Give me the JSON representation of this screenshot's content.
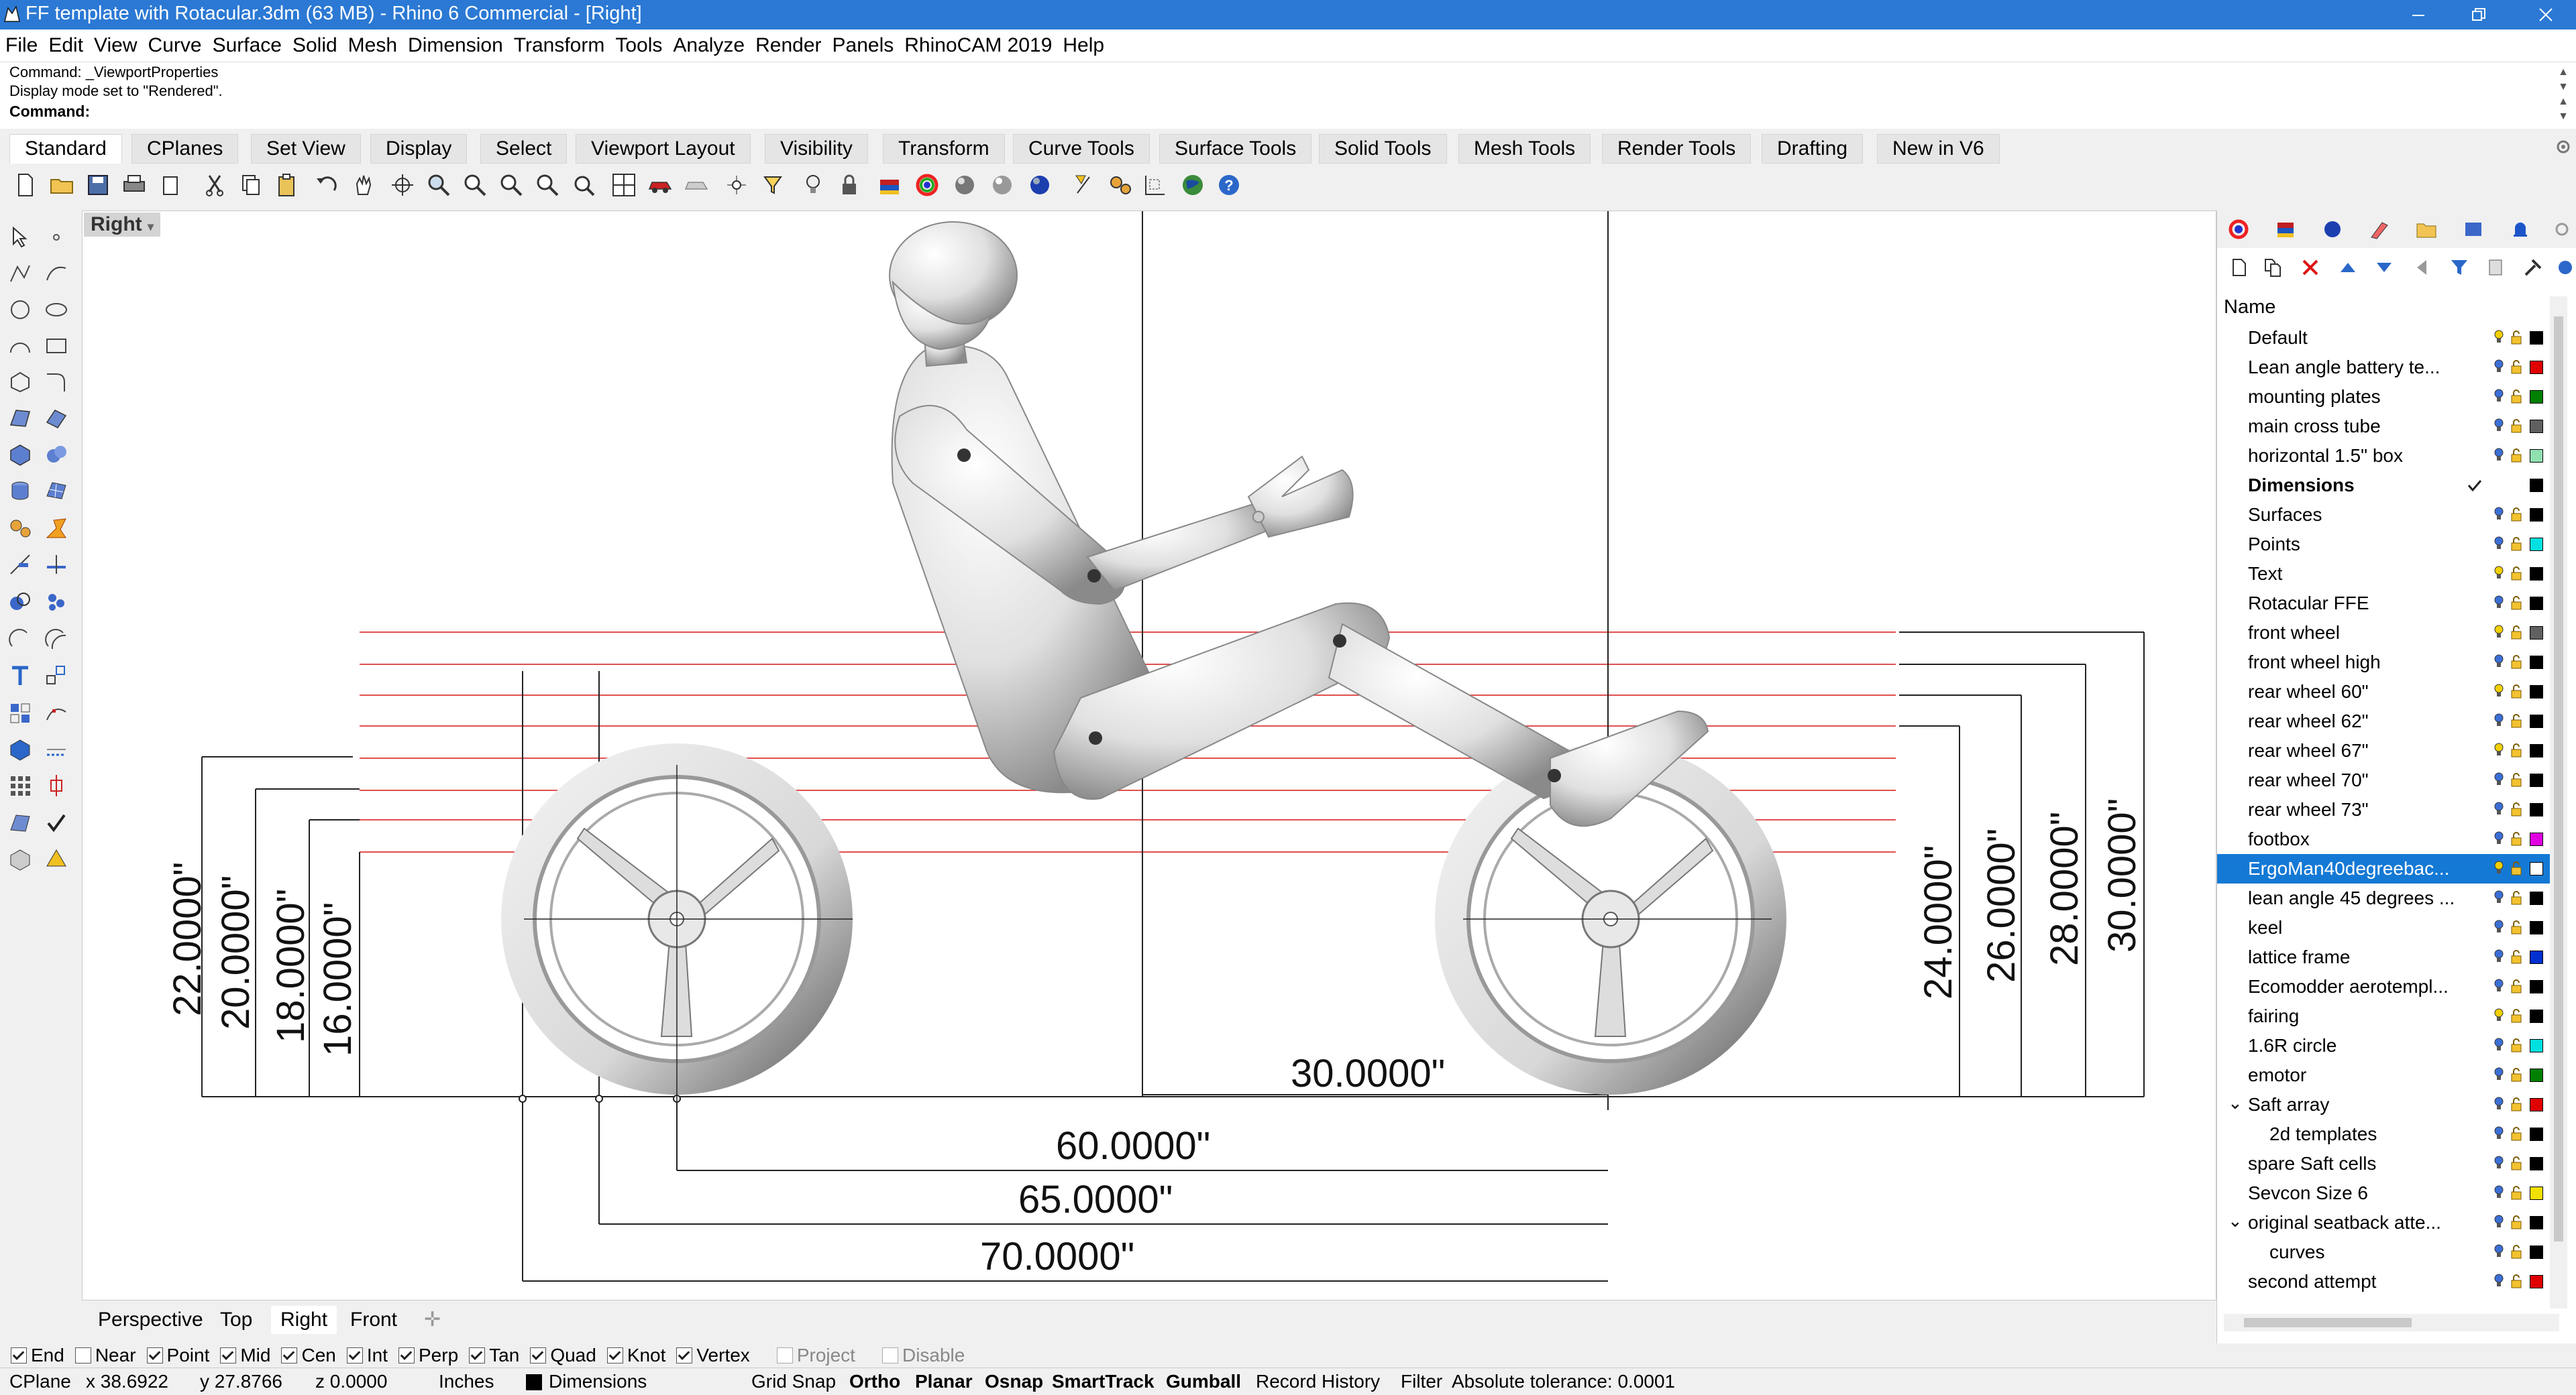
{
  "window": {
    "title": "FF template with Rotacular.3dm (63 MB) - Rhino 6 Commercial - [Right]",
    "minimize_icon": "minimize-icon",
    "restore_icon": "restore-icon",
    "close_icon": "close-icon"
  },
  "menu": [
    "File",
    "Edit",
    "View",
    "Curve",
    "Surface",
    "Solid",
    "Mesh",
    "Dimension",
    "Transform",
    "Tools",
    "Analyze",
    "Render",
    "Panels",
    "RhinoCAM 2019",
    "Help"
  ],
  "command": {
    "history": [
      "Command: _ViewportProperties",
      "Display mode set to \"Rendered\"."
    ],
    "prompt": "Command:"
  },
  "toolbar_tabs": [
    "Standard",
    "CPlanes",
    "Set View",
    "Display",
    "Select",
    "Viewport Layout",
    "Visibility",
    "Transform",
    "Curve Tools",
    "Surface Tools",
    "Solid Tools",
    "Mesh Tools",
    "Render Tools",
    "Drafting",
    "New in V6"
  ],
  "active_tab": "Standard",
  "viewport": {
    "label": "Right",
    "tabs": [
      "Perspective",
      "Top",
      "Right",
      "Front"
    ],
    "selected_tab": "Right",
    "dimensions": {
      "d22": "22.0000\"",
      "d20": "20.0000\"",
      "d18": "18.0000\"",
      "d16": "16.0000\"",
      "d24": "24.0000\"",
      "d26": "26.0000\"",
      "d28": "28.0000\"",
      "d30v": "30.0000\"",
      "d30h": "30.0000\"",
      "d60": "60.0000\"",
      "d65": "65.0000\"",
      "d70": "70.0000\""
    }
  },
  "layers": {
    "header": "Name",
    "rows": [
      {
        "name": "Default",
        "color": "#000000",
        "bulb": "#f2d000"
      },
      {
        "name": "Lean angle battery te...",
        "color": "#e00000",
        "bulb": "#3b6fd6"
      },
      {
        "name": "mounting plates",
        "color": "#008000",
        "bulb": "#3b6fd6"
      },
      {
        "name": "main cross tube",
        "color": "#606060",
        "bulb": "#3b6fd6"
      },
      {
        "name": "horizontal 1.5\" box",
        "color": "#90e0b0",
        "bulb": "#3b6fd6"
      },
      {
        "name": "Dimensions",
        "color": "#000000",
        "bulb": "",
        "current": true
      },
      {
        "name": "Surfaces",
        "color": "#000000",
        "bulb": "#3b6fd6"
      },
      {
        "name": "Points",
        "color": "#00e0e0",
        "bulb": "#3b6fd6"
      },
      {
        "name": "Text",
        "color": "#000000",
        "bulb": "#f2d000"
      },
      {
        "name": "Rotacular FFE",
        "color": "#000000",
        "bulb": "#3b6fd6"
      },
      {
        "name": "front wheel",
        "color": "#606060",
        "bulb": "#f2d000"
      },
      {
        "name": "front wheel high",
        "color": "#000000",
        "bulb": "#3b6fd6"
      },
      {
        "name": "rear wheel 60\"",
        "color": "#000000",
        "bulb": "#f2d000"
      },
      {
        "name": "rear wheel 62\"",
        "color": "#000000",
        "bulb": "#3b6fd6"
      },
      {
        "name": "rear wheel 67\"",
        "color": "#000000",
        "bulb": "#f2d000"
      },
      {
        "name": "rear wheel 70\"",
        "color": "#000000",
        "bulb": "#3b6fd6"
      },
      {
        "name": "rear wheel 73\"",
        "color": "#000000",
        "bulb": "#3b6fd6"
      },
      {
        "name": "footbox",
        "color": "#e000e0",
        "bulb": "#3b6fd6"
      },
      {
        "name": "ErgoMan40degreebac...",
        "color": "#ffffff",
        "bulb": "#f2d000",
        "selected": true
      },
      {
        "name": "lean angle 45 degrees ...",
        "color": "#000000",
        "bulb": "#3b6fd6"
      },
      {
        "name": "keel",
        "color": "#000000",
        "bulb": "#3b6fd6"
      },
      {
        "name": "lattice frame",
        "color": "#0030d0",
        "bulb": "#3b6fd6"
      },
      {
        "name": "Ecomodder aerotempl...",
        "color": "#000000",
        "bulb": "#3b6fd6"
      },
      {
        "name": "fairing",
        "color": "#000000",
        "bulb": "#f2d000"
      },
      {
        "name": "1.6R circle",
        "color": "#00e0e0",
        "bulb": "#3b6fd6"
      },
      {
        "name": "emotor",
        "color": "#008000",
        "bulb": "#3b6fd6"
      },
      {
        "name": "Saft array",
        "color": "#e00000",
        "bulb": "#3b6fd6",
        "expand": "⌄"
      },
      {
        "name": "2d templates",
        "color": "#000000",
        "bulb": "#3b6fd6",
        "indent": true
      },
      {
        "name": "spare Saft cells",
        "color": "#000000",
        "bulb": "#3b6fd6"
      },
      {
        "name": "Sevcon Size 6",
        "color": "#f2e000",
        "bulb": "#3b6fd6"
      },
      {
        "name": "original seatback atte...",
        "color": "#000000",
        "bulb": "#3b6fd6",
        "expand": "⌄"
      },
      {
        "name": "curves",
        "color": "#000000",
        "bulb": "#3b6fd6",
        "indent": true
      },
      {
        "name": "second attempt",
        "color": "#e00000",
        "bulb": "#3b6fd6"
      }
    ]
  },
  "osnaps": [
    {
      "label": "End",
      "on": true
    },
    {
      "label": "Near",
      "on": false
    },
    {
      "label": "Point",
      "on": true
    },
    {
      "label": "Mid",
      "on": true
    },
    {
      "label": "Cen",
      "on": true
    },
    {
      "label": "Int",
      "on": true
    },
    {
      "label": "Perp",
      "on": true
    },
    {
      "label": "Tan",
      "on": true
    },
    {
      "label": "Quad",
      "on": true
    },
    {
      "label": "Knot",
      "on": true
    },
    {
      "label": "Vertex",
      "on": true
    },
    {
      "label": "Project",
      "on": false,
      "disabled": true
    },
    {
      "label": "Disable",
      "on": false,
      "disabled": true
    }
  ],
  "status": {
    "cplane": "CPlane",
    "x": "x 38.6922",
    "y": "y 27.8766",
    "z": "z 0.0000",
    "units": "Inches",
    "layer": "Dimensions",
    "grid_snap": "Grid Snap",
    "ortho": "Ortho",
    "planar": "Planar",
    "osnap": "Osnap",
    "smarttrack": "SmartTrack",
    "gumball": "Gumball",
    "record_history": "Record History",
    "filter": "Filter",
    "tolerance": "Absolute tolerance: 0.0001"
  }
}
